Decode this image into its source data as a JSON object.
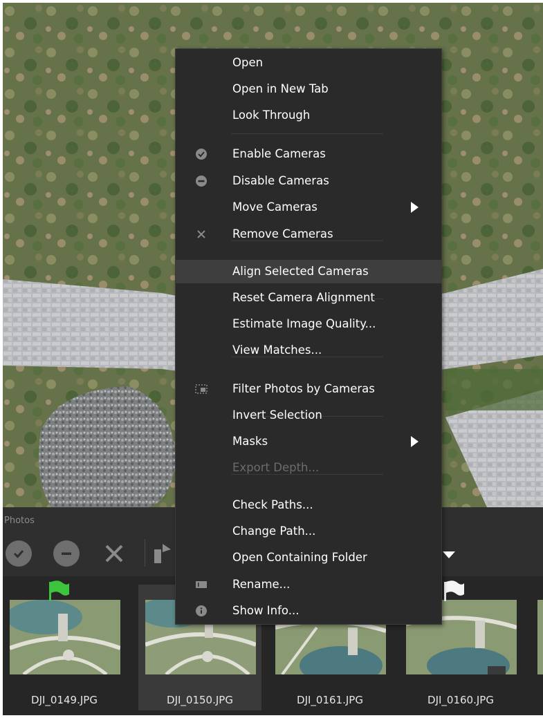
{
  "context_menu": {
    "items": [
      {
        "label": "Open"
      },
      {
        "label": "Open in New Tab"
      },
      {
        "label": "Look Through"
      },
      {
        "label": "Enable Cameras",
        "icon": "check-circle-icon"
      },
      {
        "label": "Disable Cameras",
        "icon": "minus-circle-icon"
      },
      {
        "label": "Move Cameras",
        "submenu": true
      },
      {
        "label": "Remove Cameras",
        "icon": "x-icon"
      },
      {
        "label": "Align Selected Cameras",
        "highlighted": true
      },
      {
        "label": "Reset Camera Alignment"
      },
      {
        "label": "Estimate Image Quality..."
      },
      {
        "label": "View Matches..."
      },
      {
        "label": "Filter Photos by Cameras",
        "icon": "filter-photos-icon"
      },
      {
        "label": "Invert Selection"
      },
      {
        "label": "Masks",
        "submenu": true
      },
      {
        "label": "Export Depth...",
        "disabled": true
      },
      {
        "label": "Check Paths..."
      },
      {
        "label": "Change Path..."
      },
      {
        "label": "Open Containing Folder"
      },
      {
        "label": "Rename...",
        "icon": "rename-icon"
      },
      {
        "label": "Show Info...",
        "icon": "info-icon"
      }
    ]
  },
  "photos_panel": {
    "title": "Photos",
    "toolbar": [
      "enable-icon",
      "disable-icon",
      "remove-icon",
      "align-icon",
      "dropdown-icon"
    ],
    "thumbnails": [
      {
        "filename": "DJI_0149.JPG",
        "flag": "green"
      },
      {
        "filename": "DJI_0150.JPG",
        "selected": true
      },
      {
        "filename": "DJI_0161.JPG"
      },
      {
        "filename": "DJI_0160.JPG",
        "flag": "white"
      },
      {
        "filename": ""
      }
    ]
  },
  "colors": {
    "menu_bg": "#2a2a2a",
    "menu_highlight": "#3e3e3e",
    "panel_bg": "#2f2f2f",
    "flag_green": "#3cc43c"
  }
}
